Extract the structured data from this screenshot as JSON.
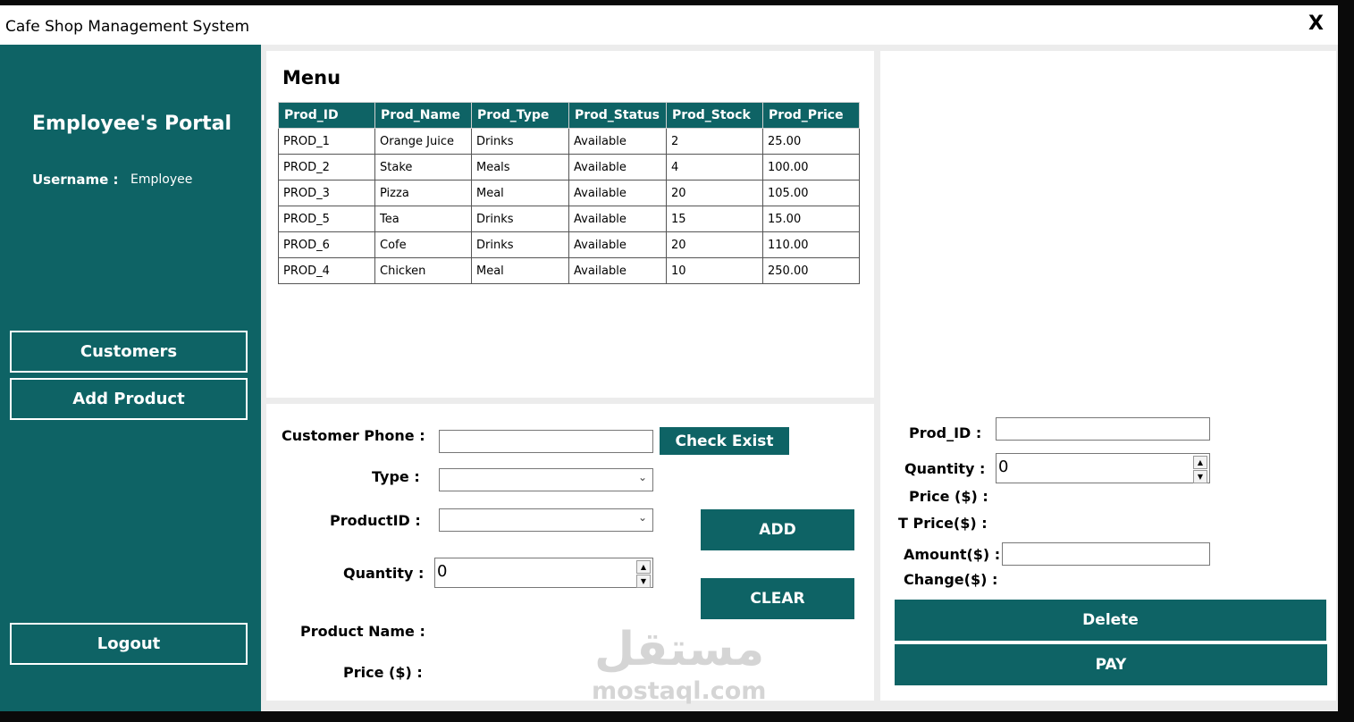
{
  "window": {
    "title": "Cafe Shop Management System",
    "close_label": "X"
  },
  "sidebar": {
    "portal_title": "Employee's Portal",
    "username_label": "Username :",
    "username_value": "Employee",
    "customers_label": "Customers",
    "add_product_label": "Add Product",
    "logout_label": "Logout"
  },
  "menu": {
    "title": "Menu",
    "columns": [
      "Prod_ID",
      "Prod_Name",
      "Prod_Type",
      "Prod_Status",
      "Prod_Stock",
      "Prod_Price"
    ],
    "rows": [
      [
        "PROD_1",
        "Orange Juice",
        "Drinks",
        "Available",
        "2",
        "25.00"
      ],
      [
        "PROD_2",
        "Stake",
        "Meals",
        "Available",
        "4",
        "100.00"
      ],
      [
        "PROD_3",
        "Pizza",
        "Meal",
        "Available",
        "20",
        "105.00"
      ],
      [
        "PROD_5",
        "Tea",
        "Drinks",
        "Available",
        "15",
        "15.00"
      ],
      [
        "PROD_6",
        "Cofe",
        "Drinks",
        "Available",
        "20",
        "110.00"
      ],
      [
        "PROD_4",
        "Chicken",
        "Meal",
        "Available",
        "10",
        "250.00"
      ]
    ]
  },
  "order_form": {
    "customer_phone_label": "Customer Phone :",
    "customer_phone_value": "",
    "check_exist_label": "Check Exist",
    "type_label": "Type :",
    "type_value": "",
    "product_id_label": "ProductID :",
    "product_id_value": "",
    "quantity_label": "Quantity :",
    "quantity_value": "0",
    "add_label": "ADD",
    "clear_label": "CLEAR",
    "product_name_label": "Product Name :",
    "price_label": "Price ($) :"
  },
  "checkout": {
    "prod_id_label": "Prod_ID :",
    "prod_id_value": "",
    "quantity_label": "Quantity :",
    "quantity_value": "0",
    "price_label": "Price ($) :",
    "total_price_label": "T Price($) :",
    "amount_label": "Amount($) :",
    "amount_value": "",
    "change_label": "Change($) :",
    "delete_label": "Delete",
    "pay_label": "PAY"
  },
  "watermark": {
    "arabic": "مستقل",
    "latin": "mostaql.com"
  },
  "colors": {
    "accent": "#0e6365",
    "panel": "#ffffff",
    "background": "#ececec"
  }
}
